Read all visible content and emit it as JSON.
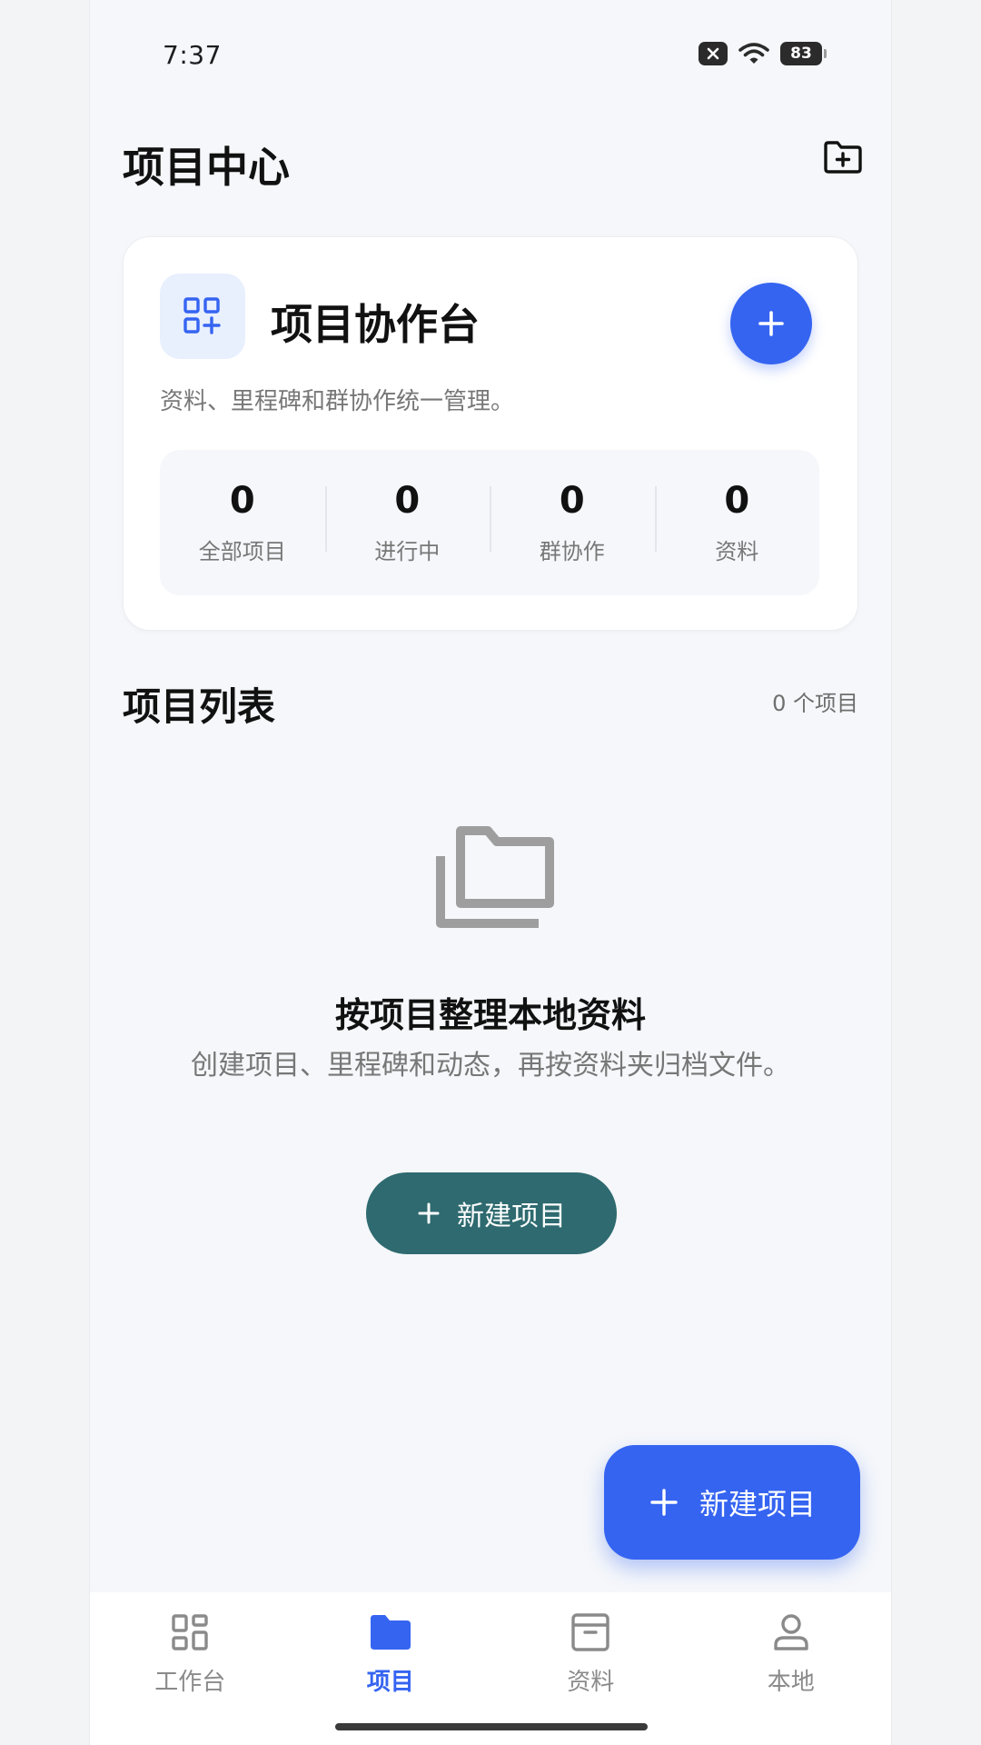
{
  "status_bar": {
    "time": "7:37",
    "battery": "83"
  },
  "header": {
    "title": "项目中心"
  },
  "card": {
    "title": "项目协作台",
    "subtitle": "资料、里程碑和群协作统一管理。",
    "stats": [
      {
        "value": "0",
        "label": "全部项目"
      },
      {
        "value": "0",
        "label": "进行中"
      },
      {
        "value": "0",
        "label": "群协作"
      },
      {
        "value": "0",
        "label": "资料"
      }
    ]
  },
  "list": {
    "title": "项目列表",
    "count": "0 个项目"
  },
  "empty_state": {
    "title": "按项目整理本地资料",
    "description": "创建项目、里程碑和动态，再按资料夹归档文件。",
    "button_label": "新建项目"
  },
  "fab": {
    "label": "新建项目"
  },
  "bottom_nav": [
    {
      "label": "工作台",
      "icon": "dashboard-icon"
    },
    {
      "label": "项目",
      "icon": "folder-icon"
    },
    {
      "label": "资料",
      "icon": "archive-icon"
    },
    {
      "label": "本地",
      "icon": "person-icon"
    }
  ],
  "colors": {
    "primary": "#3564f1",
    "teal": "#2e6a6f",
    "background": "#f5f7fa"
  }
}
